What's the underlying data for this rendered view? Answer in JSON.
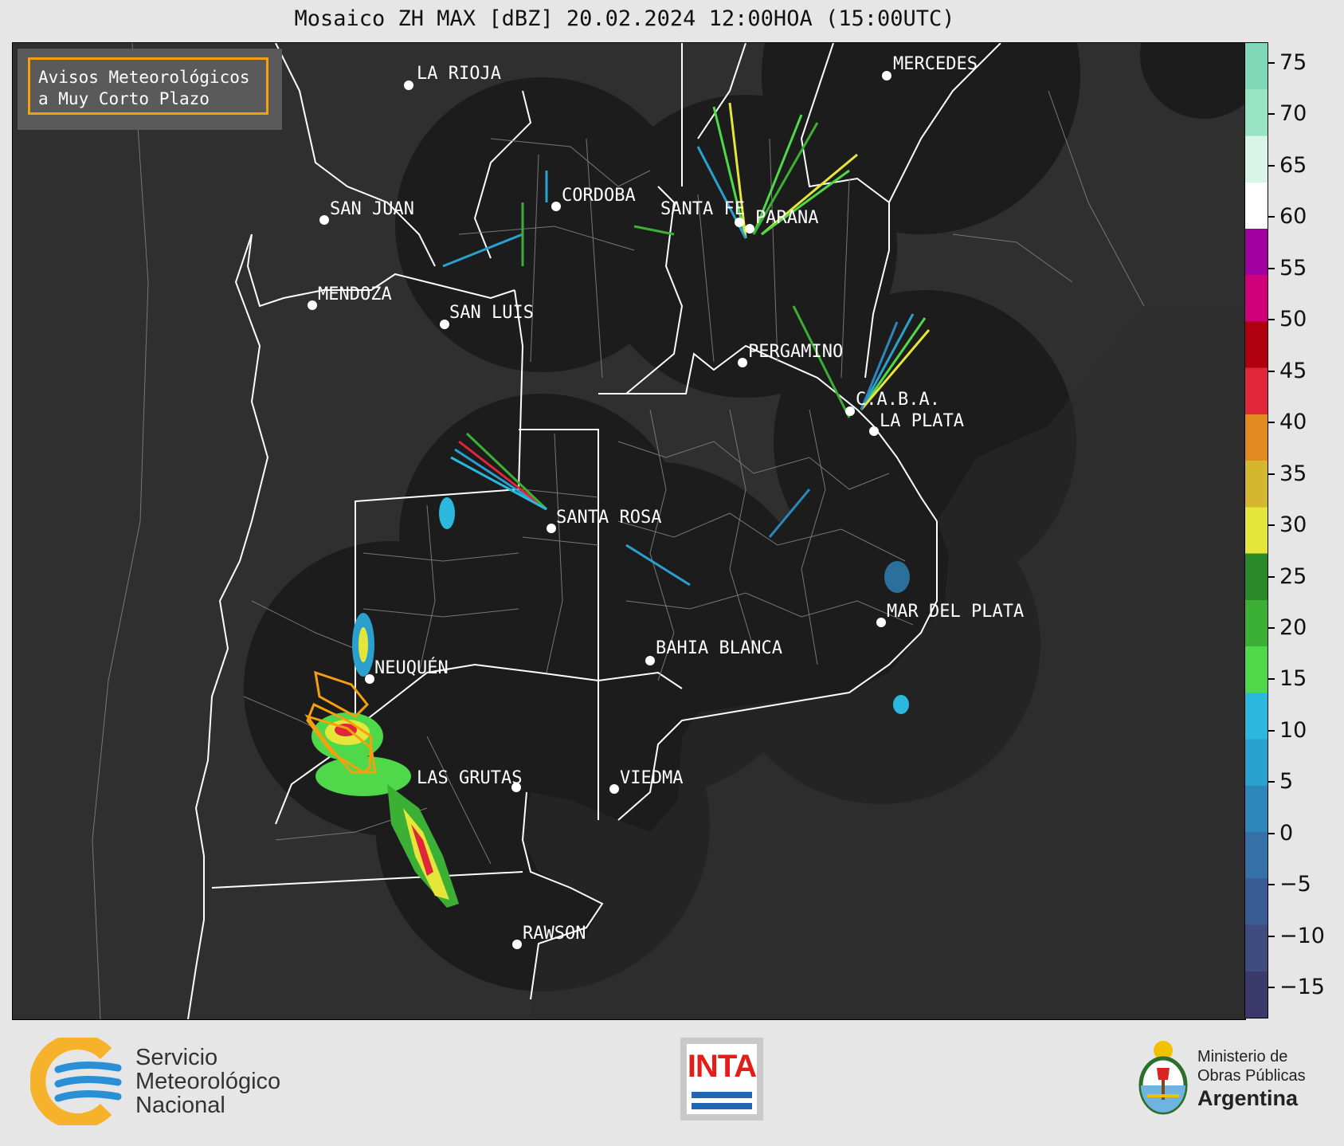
{
  "title": "Mosaico ZH MAX [dBZ] 20.02.2024 12:00HOA (15:00UTC)",
  "warning_box": {
    "line1": "Avisos Meteorológicos",
    "line2": "a Muy Corto Plazo",
    "border_color": "#f5a00f"
  },
  "cities": [
    {
      "name": "LA RIOJA"
    },
    {
      "name": "MERCEDES"
    },
    {
      "name": "CORDOBA"
    },
    {
      "name": "SAN JUAN"
    },
    {
      "name": "SANTA FE"
    },
    {
      "name": "PARANA"
    },
    {
      "name": "MENDOZA"
    },
    {
      "name": "SAN LUIS"
    },
    {
      "name": "PERGAMINO"
    },
    {
      "name": "C.A.B.A."
    },
    {
      "name": "LA PLATA"
    },
    {
      "name": "SANTA ROSA"
    },
    {
      "name": "MAR DEL PLATA"
    },
    {
      "name": "BAHIA BLANCA"
    },
    {
      "name": "NEUQUÉN"
    },
    {
      "name": "LAS GRUTAS"
    },
    {
      "name": "VIEDMA"
    },
    {
      "name": "RAWSON"
    }
  ],
  "colorbar": {
    "unit": "dBZ",
    "range": [
      -18,
      77
    ],
    "ticks": [
      "75",
      "70",
      "65",
      "60",
      "55",
      "50",
      "45",
      "40",
      "35",
      "30",
      "25",
      "20",
      "15",
      "10",
      "5",
      "0",
      "−5",
      "−10",
      "−15"
    ],
    "colors": [
      "#3b3a6a",
      "#3e4c80",
      "#3a5c94",
      "#3570a6",
      "#2f86bb",
      "#2aa0cf",
      "#2bb8df",
      "#4fd84a",
      "#3cb034",
      "#2a8a2a",
      "#e6e63a",
      "#d4b72e",
      "#e08a20",
      "#e2263a",
      "#b00010",
      "#d0007a",
      "#a000a0",
      "#ffffff",
      "#d8f5e8",
      "#98e3c3",
      "#7fd9b8"
    ]
  },
  "footer": {
    "smn": {
      "line1": "Servicio",
      "line2": "Meteorológico",
      "line3": "Nacional"
    },
    "inta": "INTA",
    "ministerio": {
      "line1": "Ministerio de",
      "line2": "Obras Públicas",
      "line3": "Argentina"
    }
  },
  "colors": {
    "map_background": "#2f2f2f",
    "radar_coverage": "#1c1c1c",
    "border_lines": "#ffffff",
    "warning_polygon": "#f5a00f"
  }
}
